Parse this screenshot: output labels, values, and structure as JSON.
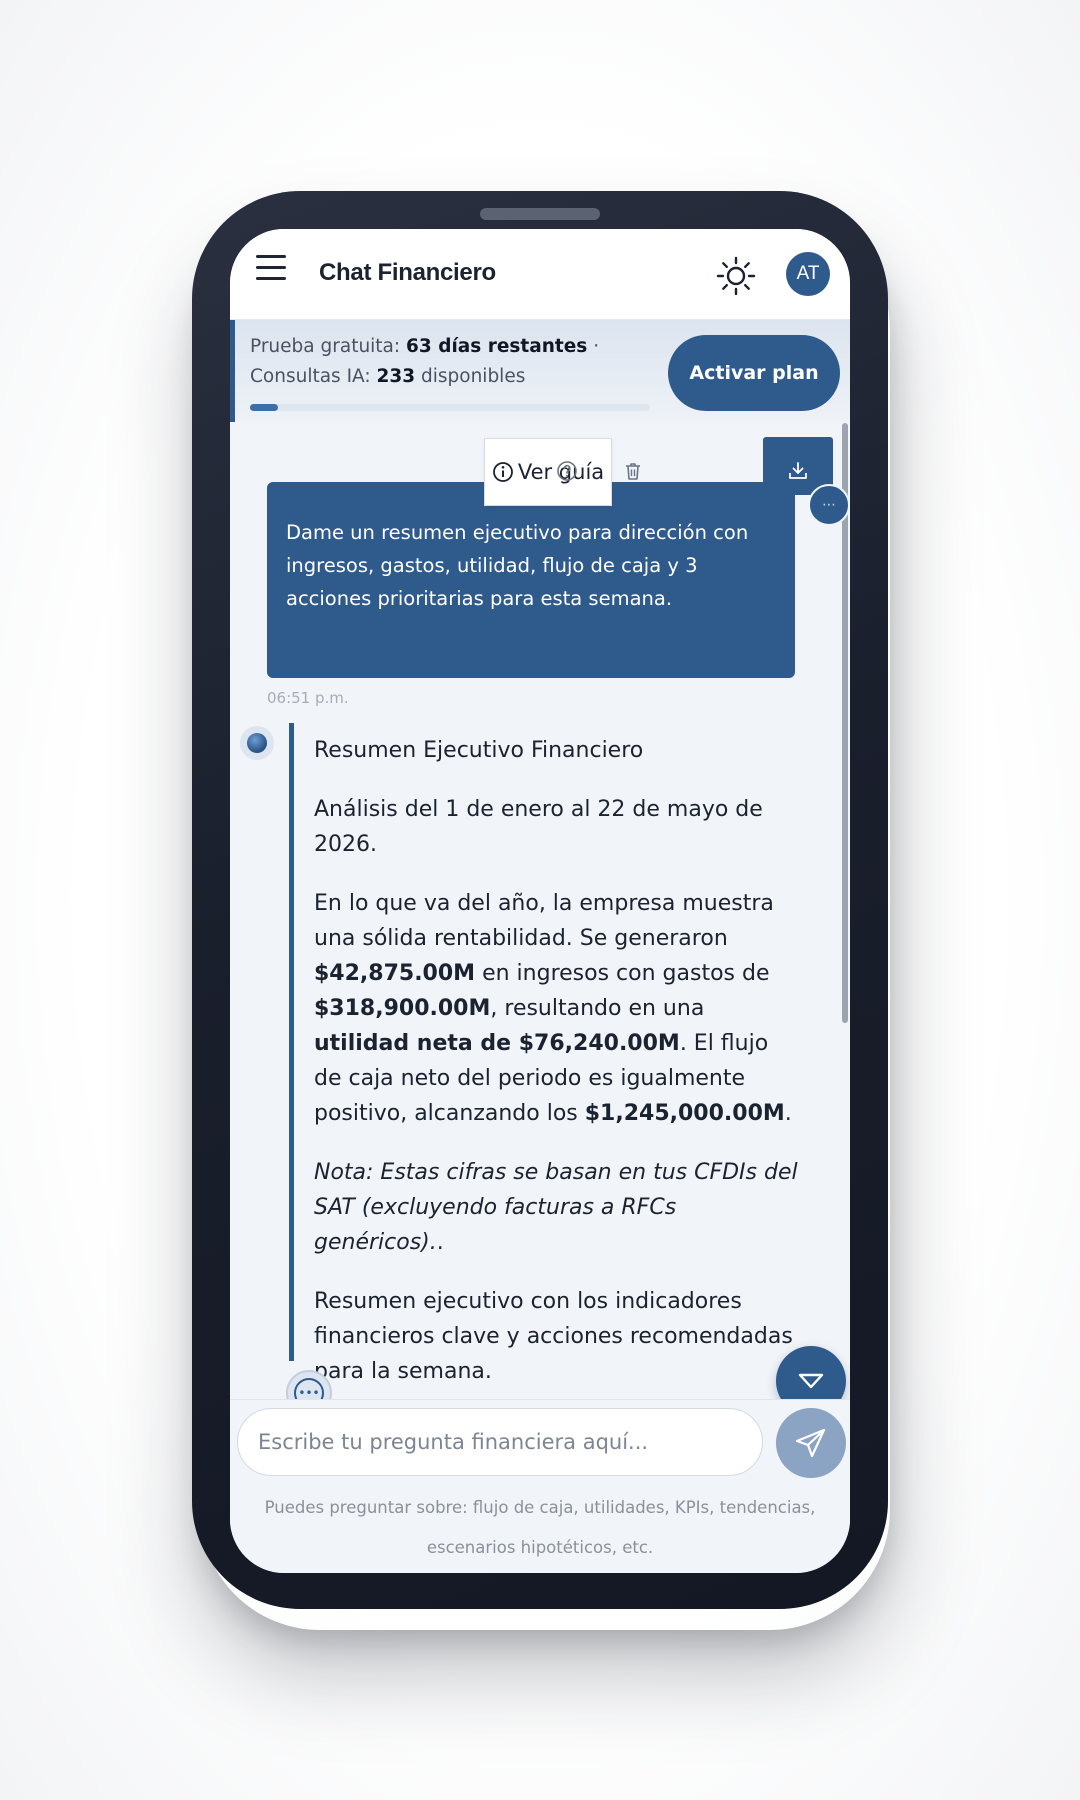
{
  "header": {
    "title": "Chat Financiero",
    "avatar_initials": "AT",
    "icons": [
      "menu-icon",
      "sun-icon"
    ]
  },
  "trial": {
    "prefix": "Prueba gratuita: ",
    "days_remaining": "63 días restantes",
    "separator": " ·",
    "queries_prefix": "Consultas IA: ",
    "queries_count": "233",
    "queries_suffix": " disponibles",
    "progress_fraction": 0.07,
    "activate_label": "Activar plan"
  },
  "toolbar": {
    "guide_label": "Ver guía",
    "icons": [
      "info-icon",
      "help-icon",
      "trash-icon",
      "download-icon"
    ]
  },
  "user_message": {
    "text": "Dame un resumen ejecutivo para dirección con ingresos, gastos, utilidad, flujo de caja y 3 acciones prioritarias para esta semana.",
    "timestamp": "06:51 p.m."
  },
  "assistant_message": {
    "title": "Resumen Ejecutivo Financiero",
    "period": "Análisis del 1 de enero al 22 de mayo de 2026.",
    "summary_p1": "En lo que va del año, la empresa muestra una sólida rentabilidad. Se generaron ",
    "income": "$42,875.00M",
    "summary_p2": " en ingresos con gastos de ",
    "expenses": "$318,900.00M",
    "summary_p3": ", resultando en una ",
    "net_label": "utilidad neta de $76,240.00M",
    "summary_p4": ". El flujo de caja neto del periodo es igualmente positivo, alcanzando los ",
    "cash_flow": "$1,245,000.00M",
    "summary_p5": ".",
    "note": "Nota: Estas cifras se basan en tus CFDIs del SAT (excluyendo facturas a RFCs genéricos).",
    "note_end": ".",
    "closing": "Resumen ejecutivo con los indicadores financieros clave y acciones recomendadas para la semana."
  },
  "composer": {
    "placeholder": "Escribe tu pregunta financiera aquí...",
    "hint": "Puedes preguntar sobre: flujo de caja, utilidades, KPIs, tendencias, escenarios hipotéticos, etc."
  },
  "colors": {
    "primary": "#2f5a8c",
    "send_disabled": "#8ba4c3",
    "screen_bg": "#f1f4f9",
    "phone_frame": "#1a1f2c"
  }
}
